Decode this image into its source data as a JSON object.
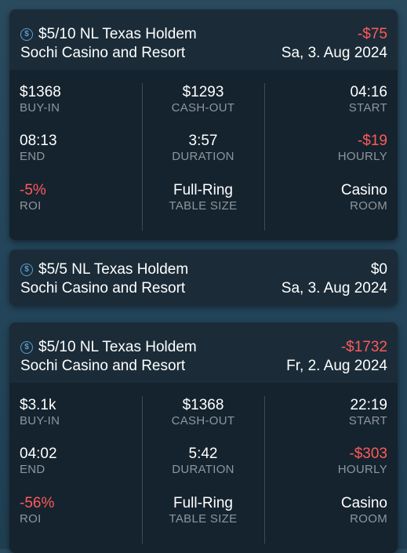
{
  "sessions": [
    {
      "game": "$5/10 NL Texas Holdem",
      "result": "-$75",
      "venue": "Sochi Casino and Resort",
      "date": "Sa, 3. Aug 2024",
      "stats": {
        "buy_in": "$1368",
        "buy_in_label": "BUY-IN",
        "cash_out": "$1293",
        "cash_out_label": "CASH-OUT",
        "start": "04:16",
        "start_label": "START",
        "end": "08:13",
        "end_label": "END",
        "duration": "3:57",
        "duration_label": "DURATION",
        "hourly": "-$19",
        "hourly_label": "HOURLY",
        "roi": "-5%",
        "roi_label": "ROI",
        "table_size": "Full-Ring",
        "table_size_label": "TABLE SIZE",
        "room": "Casino",
        "room_label": "ROOM"
      }
    },
    {
      "game": "$5/5 NL Texas Holdem",
      "result": "$0",
      "venue": "Sochi Casino and Resort",
      "date": "Sa, 3. Aug 2024"
    },
    {
      "game": "$5/10 NL Texas Holdem",
      "result": "-$1732",
      "venue": "Sochi Casino and Resort",
      "date": "Fr, 2. Aug 2024",
      "stats": {
        "buy_in": "$3.1k",
        "buy_in_label": "BUY-IN",
        "cash_out": "$1368",
        "cash_out_label": "CASH-OUT",
        "start": "22:19",
        "start_label": "START",
        "end": "04:02",
        "end_label": "END",
        "duration": "5:42",
        "duration_label": "DURATION",
        "hourly": "-$303",
        "hourly_label": "HOURLY",
        "roi": "-56%",
        "roi_label": "ROI",
        "table_size": "Full-Ring",
        "table_size_label": "TABLE SIZE",
        "room": "Casino",
        "room_label": "ROOM"
      }
    }
  ],
  "icon": "dollar-coin-icon",
  "colors": {
    "negative": "#ff5a5a",
    "neutral": "#ffffff",
    "icon_accent": "#5b9fcf",
    "card_body": "#15232e",
    "card_header": "#1b2c38",
    "label": "#8d969e"
  }
}
